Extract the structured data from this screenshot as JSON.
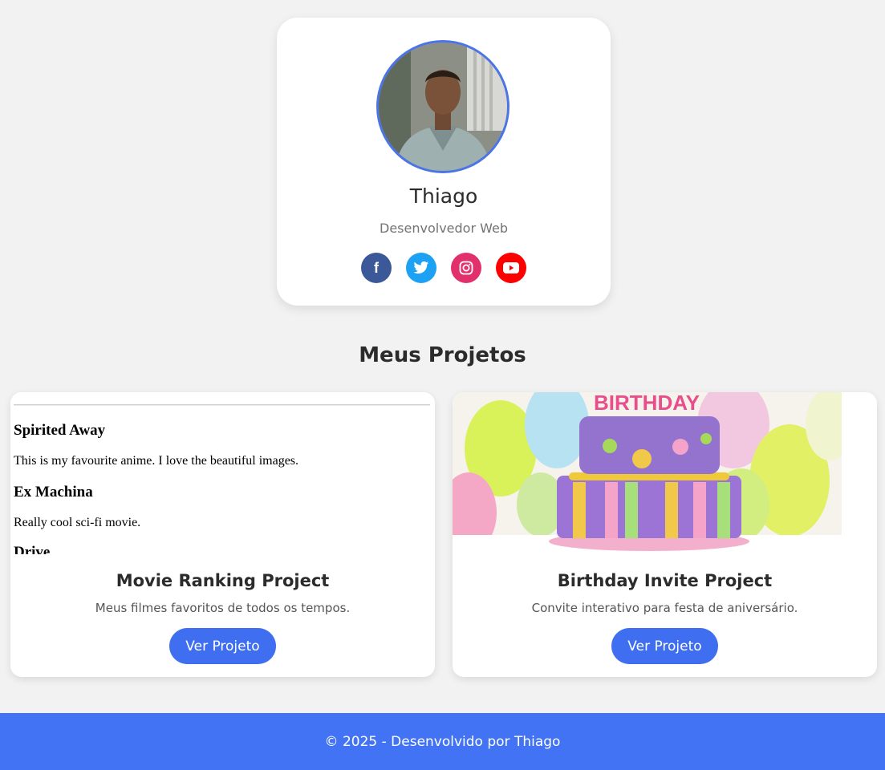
{
  "profile": {
    "name": "Thiago",
    "role": "Desenvolvedor Web",
    "socials": [
      {
        "icon": "facebook-icon",
        "glyph": "f",
        "color": "#3b5998"
      },
      {
        "icon": "twitter-icon",
        "glyph": "t",
        "color": "#1da1f2"
      },
      {
        "icon": "instagram-icon",
        "glyph": "ig",
        "color": "#e1306c"
      },
      {
        "icon": "youtube-icon",
        "glyph": "yt",
        "color": "#ff0000"
      }
    ]
  },
  "projects_section": {
    "title": "Meus Projetos",
    "items": [
      {
        "title": "Movie Ranking Project",
        "description": "Meus filmes favoritos de todos os tempos.",
        "button_label": "Ver Projeto",
        "preview": {
          "entries": [
            {
              "heading": "Spirited Away",
              "text": "This is my favourite anime. I love the beautiful images."
            },
            {
              "heading": "Ex Machina",
              "text": "Really cool sci-fi movie."
            },
            {
              "heading": "Drive",
              "text": ""
            }
          ]
        }
      },
      {
        "title": "Birthday Invite Project",
        "description": "Convite interativo para festa de aniversário.",
        "button_label": "Ver Projeto",
        "preview": {
          "cake_text": "BIRTHDAY"
        }
      }
    ]
  },
  "footer": {
    "text": "© 2025 - Desenvolvido por Thiago"
  },
  "colors": {
    "accent": "#3f6ff0",
    "footer_bg": "#4373f5",
    "avatar_ring": "#4a74e8",
    "page_bg": "#f2f2f2"
  }
}
